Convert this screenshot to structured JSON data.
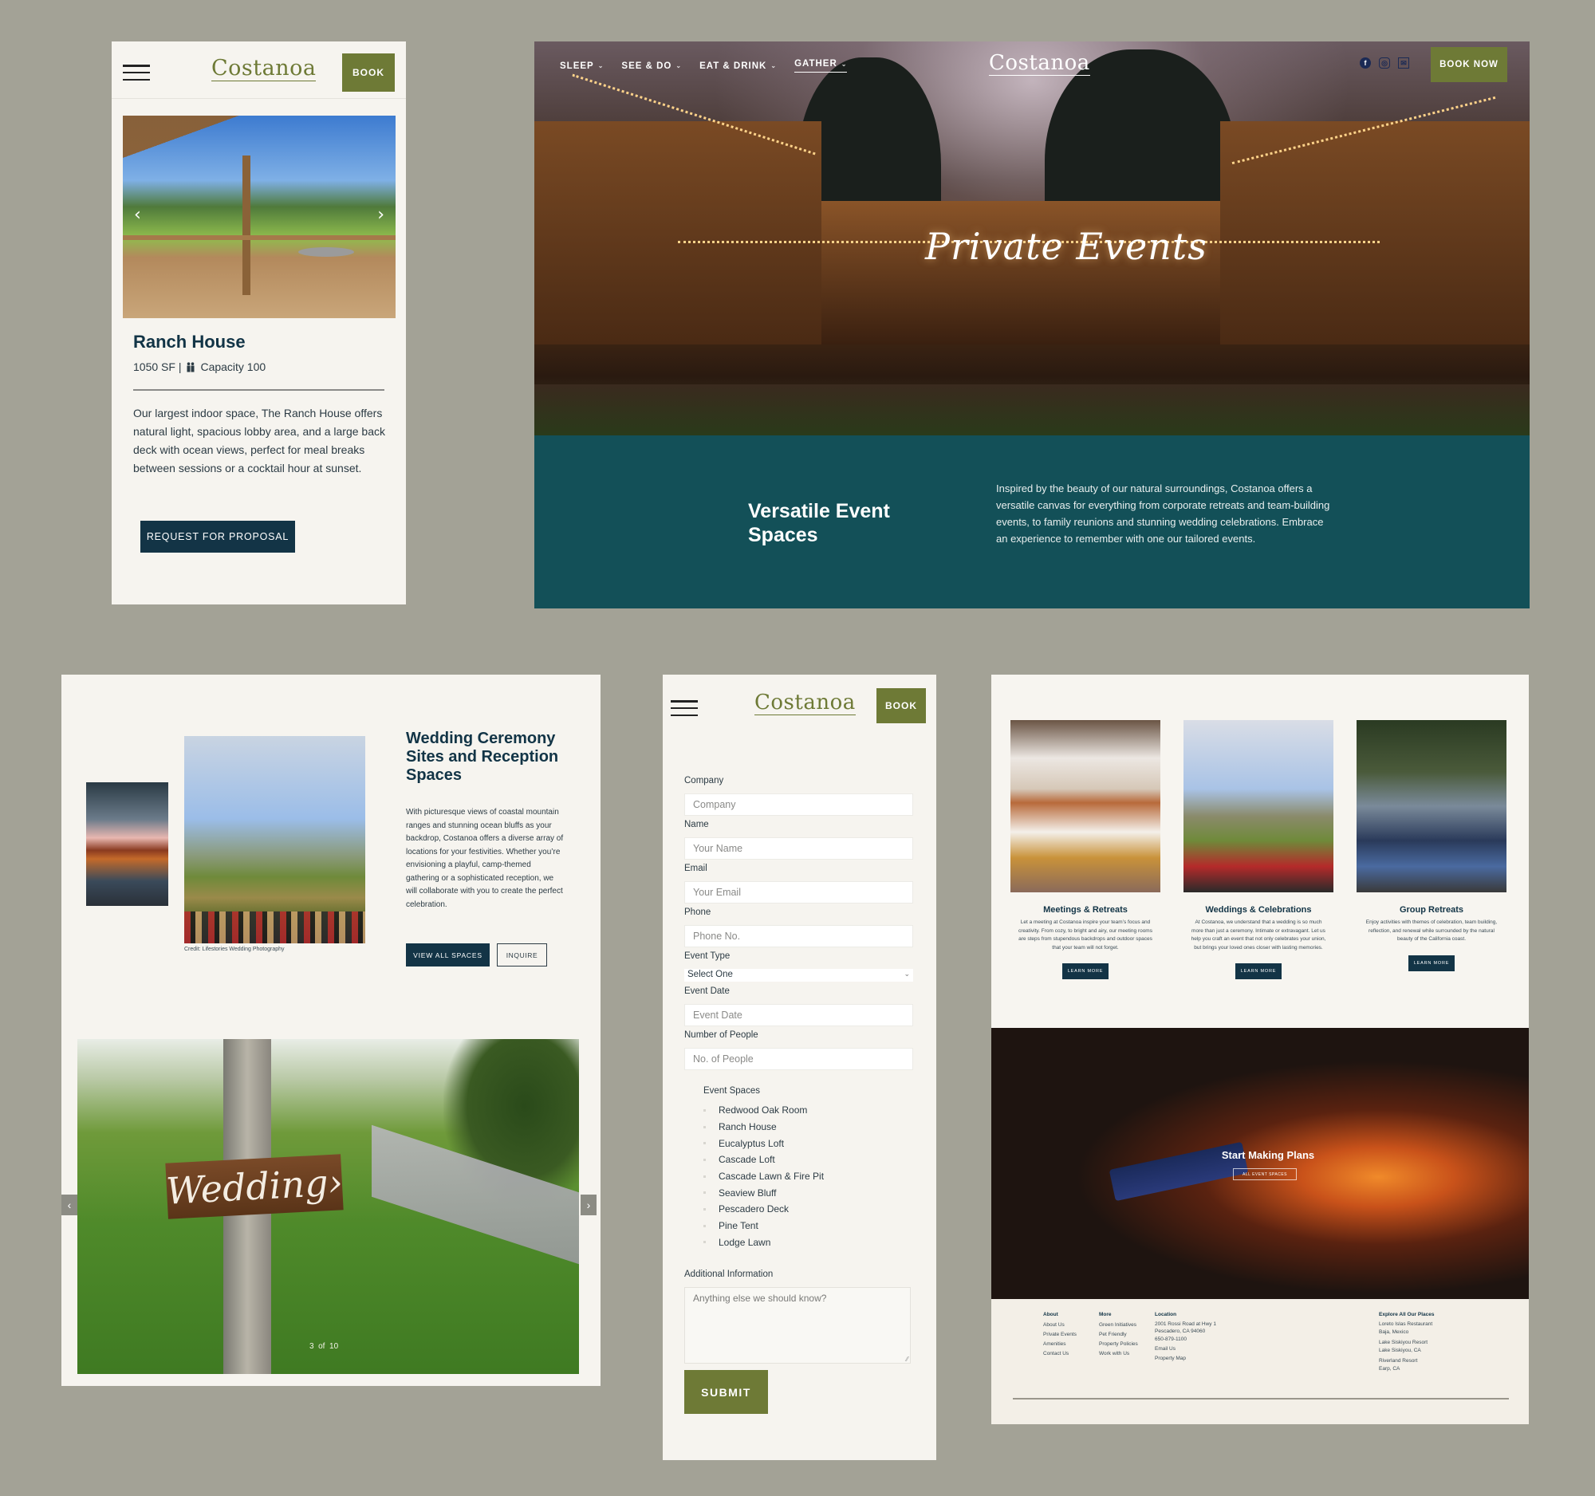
{
  "brand": {
    "logo_text": "Costanoa",
    "olive": "#6e7a36",
    "navy": "#133446",
    "teal": "#135058",
    "backdrop": "#a3a296",
    "panel_bg": "#f6f4ef"
  },
  "mobile_space": {
    "book_label": "BOOK",
    "title": "Ranch House",
    "size": "1050 SF |",
    "capacity": "Capacity 100",
    "description": "Our largest indoor space, The Ranch House offers natural light, spacious lobby area, and a large back deck with ocean views, perfect for meal breaks between sessions or a cocktail hour at sunset.",
    "cta_label": "REQUEST FOR PROPOSAL",
    "prev_icon": "‹",
    "next_icon": "›"
  },
  "desktop_hero": {
    "nav": [
      {
        "label": "SLEEP",
        "active": false
      },
      {
        "label": "SEE & DO",
        "active": false
      },
      {
        "label": "EAT & DRINK",
        "active": false
      },
      {
        "label": "GATHER",
        "active": true
      }
    ],
    "chevron": "⌄",
    "social": {
      "facebook": "f",
      "instagram": "◎",
      "email": "✉"
    },
    "book_label": "BOOK NOW",
    "hero_title": "Private Events",
    "band_title": "Versatile Event Spaces",
    "band_text": "Inspired by the beauty of our natural surroundings, Costanoa offers a versatile canvas for everything from corporate retreats and team-building events, to family reunions and stunning wedding celebrations. Embrace an experience to remember with one our tailored events."
  },
  "weddings": {
    "photo_credit": "Credit: Lifestories Wedding Photography",
    "title": "Wedding Ceremony Sites and Reception Spaces",
    "description": "With picturesque views of coastal mountain ranges and stunning ocean bluffs as your backdrop, Costanoa offers a diverse array of locations for your festivities. Whether you’re envisioning a playful, camp-themed gathering or a sophisticated reception, we will collaborate with you to create the perfect celebration.",
    "view_all_label": "VIEW ALL SPACES",
    "inquire_label": "INQUIRE",
    "sign_text": "Wedding›",
    "slide_current": 3,
    "slide_total": 10,
    "slide_sep": "of",
    "prev_icon": "‹",
    "next_icon": "›"
  },
  "form": {
    "book_label": "BOOK",
    "fields": [
      {
        "label": "Company",
        "placeholder": "Company"
      },
      {
        "label": "Name",
        "placeholder": "Your Name"
      },
      {
        "label": "Email",
        "placeholder": "Your Email"
      },
      {
        "label": "Phone",
        "placeholder": "Phone No."
      }
    ],
    "event_type": {
      "label": "Event Type",
      "value": "Select One",
      "chevron": "⌄"
    },
    "fields_after": [
      {
        "label": "Event Date",
        "placeholder": "Event Date"
      },
      {
        "label": "Number of People",
        "placeholder": "No. of People"
      }
    ],
    "spaces_title": "Event Spaces",
    "spaces": [
      "Redwood Oak Room",
      "Ranch House",
      "Eucalyptus Loft",
      "Cascade Loft",
      "Cascade Lawn & Fire Pit",
      "Seaview Bluff",
      "Pescadero Deck",
      "Pine Tent",
      "Lodge Lawn"
    ],
    "additional_label": "Additional Information",
    "additional_placeholder": "Anything else we should know?",
    "submit_label": "SUBMIT"
  },
  "events_page": {
    "cards": [
      {
        "title": "Meetings & Retreats",
        "text": "Let a meeting at Costanoa inspire your team’s focus and creativity. From cozy, to bright and airy, our meeting rooms are steps from stupendous backdrops and outdoor spaces that your team will not forget.",
        "cta": "LEARN MORE"
      },
      {
        "title": "Weddings & Celebrations",
        "text": "At Costanoa, we understand that a wedding is so much more than just a ceremony. Intimate or extravagant. Let us help you craft an event that not only celebrates your union, but brings your loved ones closer with lasting memories.",
        "cta": "LEARN MORE"
      },
      {
        "title": "Group Retreats",
        "text": "Enjoy activities with themes of celebration, team building, reflection, and renewal while surrounded by the natural beauty of the California coast.",
        "cta": "LEARN MORE"
      }
    ],
    "cta_title": "Start Making Plans",
    "cta_button": "ALL EVENT SPACES",
    "footer": {
      "about": {
        "heading": "About",
        "links": [
          "About Us",
          "Private Events",
          "Amenities",
          "Contact Us"
        ]
      },
      "more": {
        "heading": "More",
        "links": [
          "Green Initiatives",
          "Pet Friendly",
          "Property Policies",
          "Work with Us"
        ]
      },
      "location": {
        "heading": "Location",
        "address1": "2001 Rossi Road at Hwy 1",
        "address2": "Pescadero, CA 94060",
        "phone": "650-879-1100",
        "email": "Email Us",
        "map": "Property Map"
      },
      "explore": {
        "heading": "Explore All Our Places",
        "places": [
          {
            "name": "Loreto Islas Restaurant",
            "loc": "Baja, Mexico"
          },
          {
            "name": "Lake Siskiyou Resort",
            "loc": "Lake Siskiyou, CA"
          },
          {
            "name": "Riverland Resort",
            "loc": "Earp, CA"
          }
        ]
      }
    }
  }
}
